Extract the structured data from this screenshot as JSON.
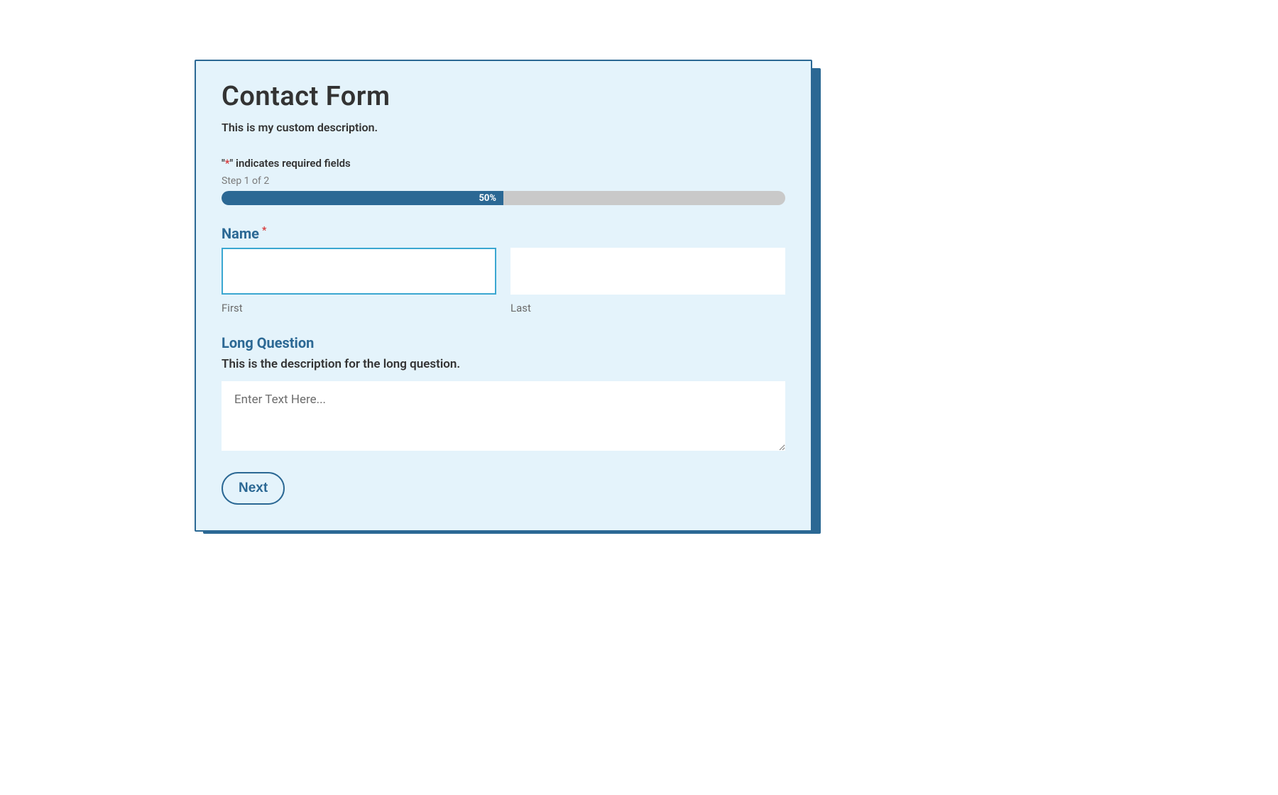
{
  "form": {
    "title": "Contact Form",
    "description": "This is my custom description.",
    "required_note_prefix": "\"",
    "required_note_asterisk": "*",
    "required_note_suffix": "\" indicates required fields",
    "step_label": "Step 1 of 2",
    "progress": {
      "percent": 50,
      "text": "50%"
    },
    "fields": {
      "name": {
        "label": "Name",
        "required_marker": "*",
        "first": {
          "value": "",
          "sub_label": "First"
        },
        "last": {
          "value": "",
          "sub_label": "Last"
        }
      },
      "long_question": {
        "label": "Long Question",
        "description": "This is the description for the long question.",
        "placeholder": "Enter Text Here...",
        "value": ""
      }
    },
    "next_button": "Next"
  }
}
